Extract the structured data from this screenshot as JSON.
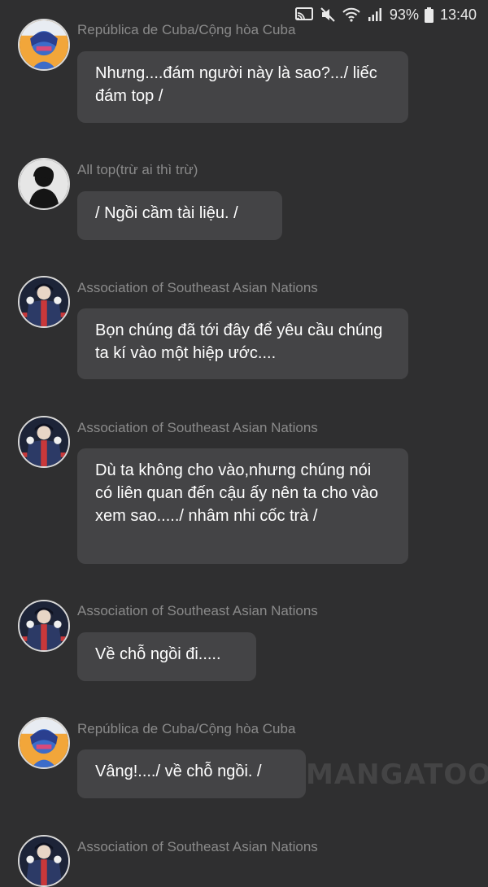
{
  "status_bar": {
    "icons": [
      "cast-icon",
      "mute-icon",
      "wifi-icon",
      "signal-icon"
    ],
    "battery_percent": "93%",
    "time": "13:40"
  },
  "messages": [
    {
      "sender": "República de Cuba/Cộng hòa Cuba",
      "avatar": "cuba-avatar",
      "text": "Nhưng....đám người này là sao?.../ liếc đám top /"
    },
    {
      "sender": "All top(trừ ai thì trừ)",
      "avatar": "silhouette-avatar",
      "text": "/ Ngồi cầm tài liệu. /"
    },
    {
      "sender": "Association of Southeast Asian Nations",
      "avatar": "asean-avatar",
      "text": "Bọn chúng đã tới đây để yêu cầu chúng ta kí vào một hiệp ước...."
    },
    {
      "sender": "Association of Southeast Asian Nations",
      "avatar": "asean-avatar",
      "text": "Dù ta không cho vào,nhưng chúng nói có liên quan đến cậu ấy nên ta cho vào xem sao...../ nhâm nhi cốc trà /"
    },
    {
      "sender": "Association of Southeast Asian Nations",
      "avatar": "asean-avatar",
      "text": "Về chỗ ngồi đi....."
    },
    {
      "sender": "República de Cuba/Cộng hòa Cuba",
      "avatar": "cuba-avatar",
      "text": "Vâng!..../ về chỗ ngồi. /"
    },
    {
      "sender": "Association of Southeast Asian Nations",
      "avatar": "asean-avatar",
      "text": ""
    }
  ],
  "watermark": "MANGATOON"
}
